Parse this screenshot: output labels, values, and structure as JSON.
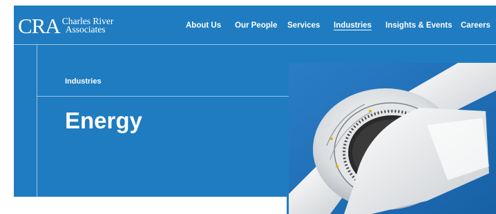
{
  "logo": {
    "mark": "CRA",
    "line1": "Charles River",
    "line2": "Associates"
  },
  "nav": [
    {
      "label": "About Us",
      "active": false
    },
    {
      "label": "Our People",
      "active": false
    },
    {
      "label": "Services",
      "active": false
    },
    {
      "label": "Industries",
      "active": true
    },
    {
      "label": "Insights & Events",
      "active": false
    },
    {
      "label": "Careers",
      "active": false
    }
  ],
  "hero": {
    "breadcrumb": "Industries",
    "title": "Energy",
    "image_subject": "wind-turbine-hub"
  },
  "colors": {
    "brand_blue": "#1f7cc0",
    "sky_blue": "#1d6fb8",
    "text": "#ffffff"
  }
}
